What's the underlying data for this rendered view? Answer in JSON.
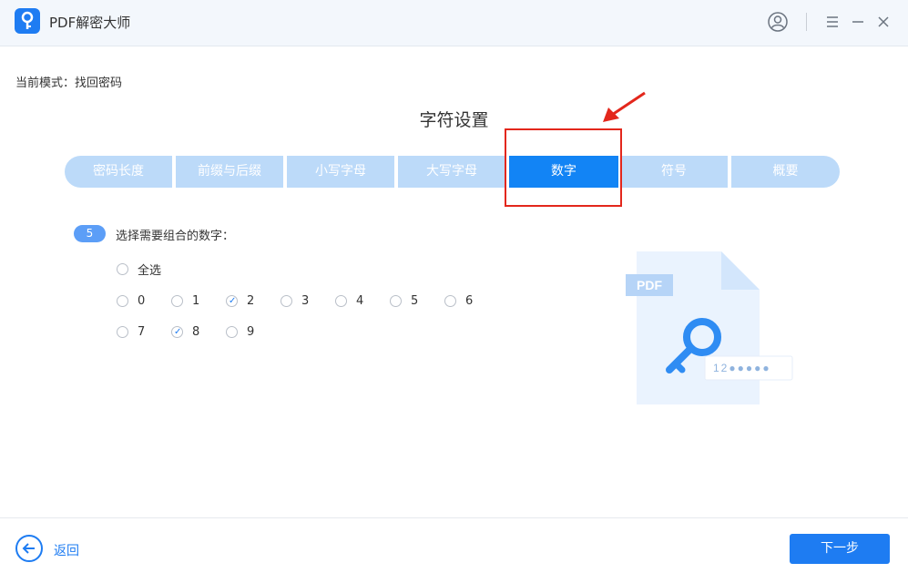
{
  "app": {
    "title": "PDF解密大师"
  },
  "mode": {
    "text": "当前模式：找回密码"
  },
  "section": {
    "title": "字符设置"
  },
  "tabs": [
    {
      "label": "密码长度"
    },
    {
      "label": "前缀与后缀"
    },
    {
      "label": "小写字母"
    },
    {
      "label": "大写字母"
    },
    {
      "label": "数字",
      "active": true
    },
    {
      "label": "符号"
    },
    {
      "label": "概要"
    }
  ],
  "step": {
    "number": "5",
    "label": "选择需要组合的数字："
  },
  "select_all": {
    "label": "全选",
    "checked": false
  },
  "digits": [
    {
      "label": "0",
      "checked": false
    },
    {
      "label": "1",
      "checked": false
    },
    {
      "label": "2",
      "checked": true
    },
    {
      "label": "3",
      "checked": false
    },
    {
      "label": "4",
      "checked": false
    },
    {
      "label": "5",
      "checked": false
    },
    {
      "label": "6",
      "checked": false
    },
    {
      "label": "7",
      "checked": false
    },
    {
      "label": "8",
      "checked": true
    },
    {
      "label": "9",
      "checked": false
    }
  ],
  "illustration": {
    "pdf_tag": "PDF",
    "password_text": "12●●●●●"
  },
  "footer": {
    "back_label": "返回",
    "next_label": "下一步"
  },
  "colors": {
    "accent": "#1e7cf2",
    "tab_inactive": "#bcdaf9",
    "highlight": "#e3271c"
  }
}
